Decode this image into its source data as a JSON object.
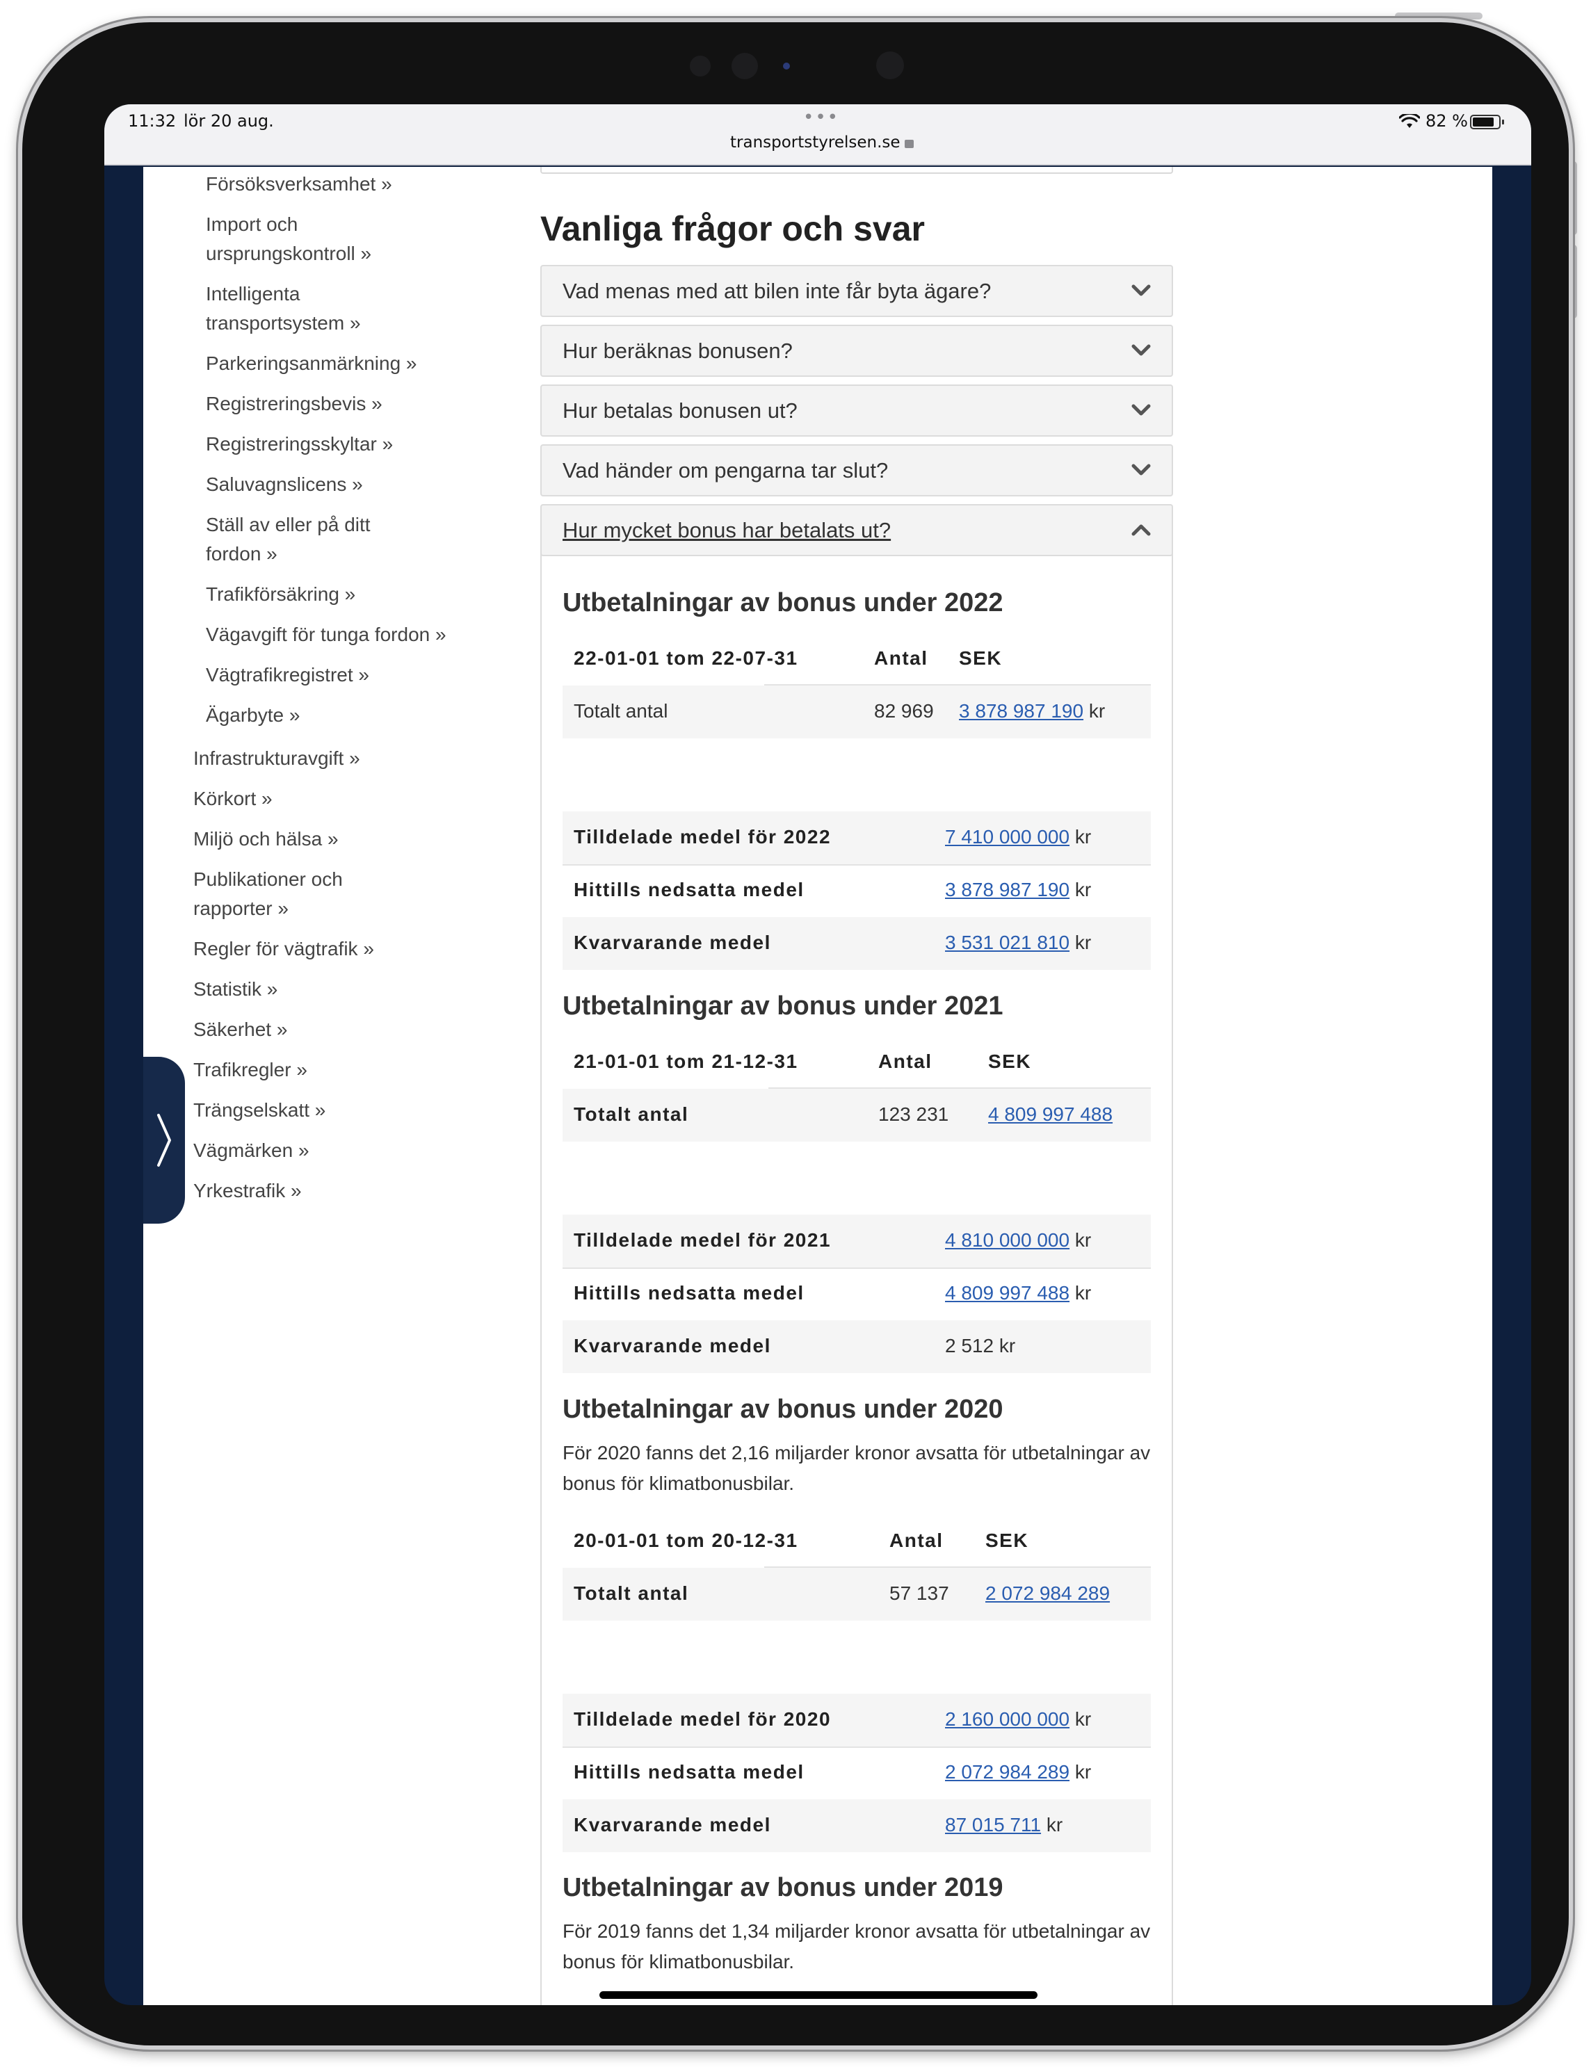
{
  "status_bar": {
    "time": "11:32",
    "date": "lör 20 aug.",
    "url": "transportstyrelsen.se",
    "battery": "82 %"
  },
  "sidebar": {
    "sub_items": [
      "Försöksverksamhet »",
      "Import och\nursprungskontroll »",
      "Intelligenta\ntransportsystem »",
      "Parkeringsanmärkning »",
      "Registreringsbevis »",
      "Registreringsskyltar »",
      "Saluvagnslicens »",
      "Ställ av eller på ditt\nfordon »",
      "Trafikförsäkring »",
      "Vägavgift för tunga fordon »",
      "Vägtrafikregistret »",
      "Ägarbyte »"
    ],
    "top_items": [
      "Infrastrukturavgift »",
      "Körkort »",
      "Miljö och hälsa  »",
      "Publikationer och\nrapporter »",
      "Regler för vägtrafik »",
      "Statistik »",
      "Säkerhet »",
      "Trafikregler »",
      "Trängselskatt  »",
      "Vägmärken »",
      "Yrkestrafik »"
    ]
  },
  "faq": {
    "heading": "Vanliga frågor och svar",
    "items": [
      "Vad menas med att bilen inte får byta ägare?",
      "Hur beräknas bonusen?",
      "Hur betalas bonusen ut?",
      "Vad händer om pengarna tar slut?",
      "Hur mycket bonus har betalats ut?"
    ]
  },
  "payouts": {
    "y2022": {
      "title": "Utbetalningar av bonus under 2022",
      "period": "22-01-01 tom 22-07-31",
      "col_count": "Antal",
      "col_sek": "SEK",
      "total_label": "Totalt antal",
      "total_count": "82 969",
      "total_sek": "3 878 987 190",
      "unit": "kr",
      "allocated_label": "Tilldelade medel för 2022",
      "allocated": "7 410 000 000",
      "spent_label": "Hittills nedsatta medel",
      "spent": "3 878 987 190",
      "remaining_label": "Kvarvarande medel",
      "remaining": "3 531 021 810"
    },
    "y2021": {
      "title": "Utbetalningar av bonus under 2021",
      "period": "21-01-01 tom 21-12-31",
      "col_count": "Antal",
      "col_sek": "SEK",
      "total_label": "Totalt antal",
      "total_count": "123 231",
      "total_sek": "4 809 997 488",
      "allocated_label": "Tilldelade medel för 2021",
      "allocated": "4 810 000 000",
      "spent_label": "Hittills nedsatta medel",
      "spent": "4 809 997 488",
      "remaining_label": "Kvarvarande medel",
      "remaining": "2 512",
      "unit": "kr"
    },
    "y2020": {
      "title": "Utbetalningar av bonus under 2020",
      "note": "För 2020 fanns det 2,16 miljarder kronor avsatta för utbetalningar av bonus för klimatbonusbilar.",
      "period": "20-01-01 tom 20-12-31",
      "col_count": "Antal",
      "col_sek": "SEK",
      "total_label": "Totalt antal",
      "total_count": "57 137",
      "total_sek": "2 072 984 289",
      "allocated_label": "Tilldelade medel för 2020",
      "allocated": "2 160 000 000",
      "spent_label": "Hittills nedsatta medel",
      "spent": "2 072 984 289",
      "remaining_label": "Kvarvarande medel",
      "remaining": "87 015 711",
      "unit": "kr"
    },
    "y2019": {
      "title": "Utbetalningar av bonus under 2019",
      "note": "För 2019 fanns det 1,34 miljarder kronor avsatta för utbetalningar av bonus för klimatbonusbilar."
    }
  }
}
